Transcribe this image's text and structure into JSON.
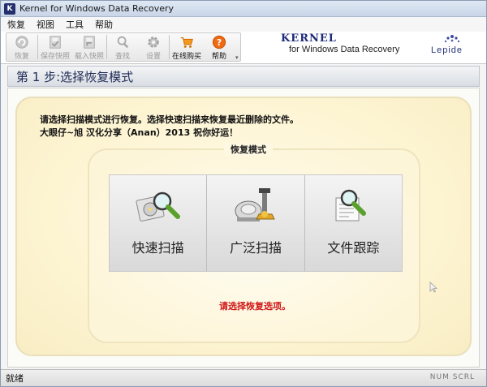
{
  "window": {
    "title": "Kernel for Windows Data Recovery",
    "app_icon_letter": "K"
  },
  "menu": {
    "items": [
      "恢复",
      "视图",
      "工具",
      "帮助"
    ]
  },
  "toolbar": {
    "buttons": [
      {
        "label": "恢复",
        "icon": "recover-icon"
      },
      {
        "label": "保存快照",
        "icon": "save-snapshot-icon"
      },
      {
        "label": "载入快照",
        "icon": "load-snapshot-icon"
      },
      {
        "label": "查找",
        "icon": "search-icon"
      },
      {
        "label": "设置",
        "icon": "gear-icon"
      },
      {
        "label": "在线购买",
        "icon": "cart-icon"
      },
      {
        "label": "帮助",
        "icon": "help-icon"
      }
    ]
  },
  "brand": {
    "kernel": "KERNEL",
    "product": "for Windows Data Recovery",
    "lepide": "Lepide"
  },
  "step": {
    "title": "第 1 步:选择恢复模式"
  },
  "instructions": {
    "line1": "请选择扫描模式进行恢复。选择快速扫描来恢复最近删除的文件。",
    "line2": "大眼仔~旭 汉化分享（Anan）2013 祝你好运！"
  },
  "mode_group": {
    "label": "恢复模式"
  },
  "modes": [
    {
      "label": "快速扫描",
      "icon": "quick-scan-icon"
    },
    {
      "label": "广泛扫描",
      "icon": "extensive-scan-icon"
    },
    {
      "label": "文件跟踪",
      "icon": "file-trace-icon"
    }
  ],
  "hint": "请选择恢复选项。",
  "status": {
    "text": "就绪",
    "keys": "NUM SCRL"
  },
  "colors": {
    "accent": "#1d2a78",
    "hint_red": "#d01818",
    "panel_bg": "#fdf4d2"
  }
}
